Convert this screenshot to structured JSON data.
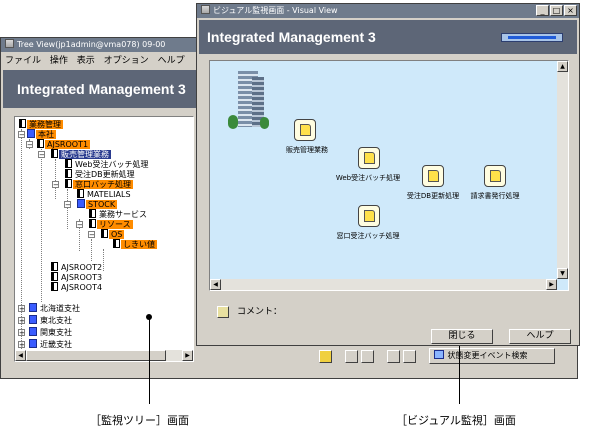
{
  "tree_window": {
    "title": "Tree View(jp1admin@vma078) 09-00",
    "menu": [
      "ファイル",
      "操作",
      "表示",
      "オプション",
      "ヘルプ"
    ],
    "banner": "Integrated Management 3",
    "tree": [
      {
        "label": "業務管理",
        "icon": "job",
        "style": "orange"
      },
      {
        "label": "本社",
        "icon": "network",
        "style": "orange"
      },
      {
        "label": "AJSROOT1",
        "icon": "job",
        "style": "orange"
      },
      {
        "label": "販売管理業務",
        "icon": "job",
        "style": "blue"
      },
      {
        "label": "Web受注バッチ処理",
        "icon": "job",
        "style": "none"
      },
      {
        "label": "受注DB更新処理",
        "icon": "job",
        "style": "none"
      },
      {
        "label": "窓口バッチ処理",
        "icon": "job",
        "style": "orange"
      },
      {
        "label": "MATELIALS",
        "icon": "job",
        "style": "none"
      },
      {
        "label": "STOCK",
        "icon": "network",
        "style": "orange"
      },
      {
        "label": "業務サービス",
        "icon": "job",
        "style": "none"
      },
      {
        "label": "リソース",
        "icon": "job",
        "style": "orange"
      },
      {
        "label": "OS",
        "icon": "job",
        "style": "orange"
      },
      {
        "label": "しきい値",
        "icon": "job",
        "style": "orange"
      },
      {
        "label": "AJSROOT2",
        "icon": "job",
        "style": "none"
      },
      {
        "label": "AJSROOT3",
        "icon": "job",
        "style": "none"
      },
      {
        "label": "AJSROOT4",
        "icon": "job",
        "style": "none"
      },
      {
        "label": "北海道支社",
        "icon": "network",
        "style": "none"
      },
      {
        "label": "東北支社",
        "icon": "network",
        "style": "none"
      },
      {
        "label": "関東支社",
        "icon": "network",
        "style": "none"
      },
      {
        "label": "近畿支社",
        "icon": "network",
        "style": "none"
      }
    ],
    "bottom_button_label": "状態変更イベント検索"
  },
  "visual_window": {
    "title": "ビジュアル監視画面 - Visual View",
    "banner": "Integrated Management 3",
    "map_items": [
      {
        "label": "販売管理業務"
      },
      {
        "label": "Web受注バッチ処理"
      },
      {
        "label": "受注DB更新処理"
      },
      {
        "label": "請求書発行処理"
      },
      {
        "label": "窓口受注バッチ処理"
      }
    ],
    "comment_label": "コメント：",
    "close_button": "閉じる",
    "help_button": "ヘルプ"
  },
  "captions": {
    "tree": "［監視ツリー］画面",
    "visual": "［ビジュアル監視］画面"
  }
}
